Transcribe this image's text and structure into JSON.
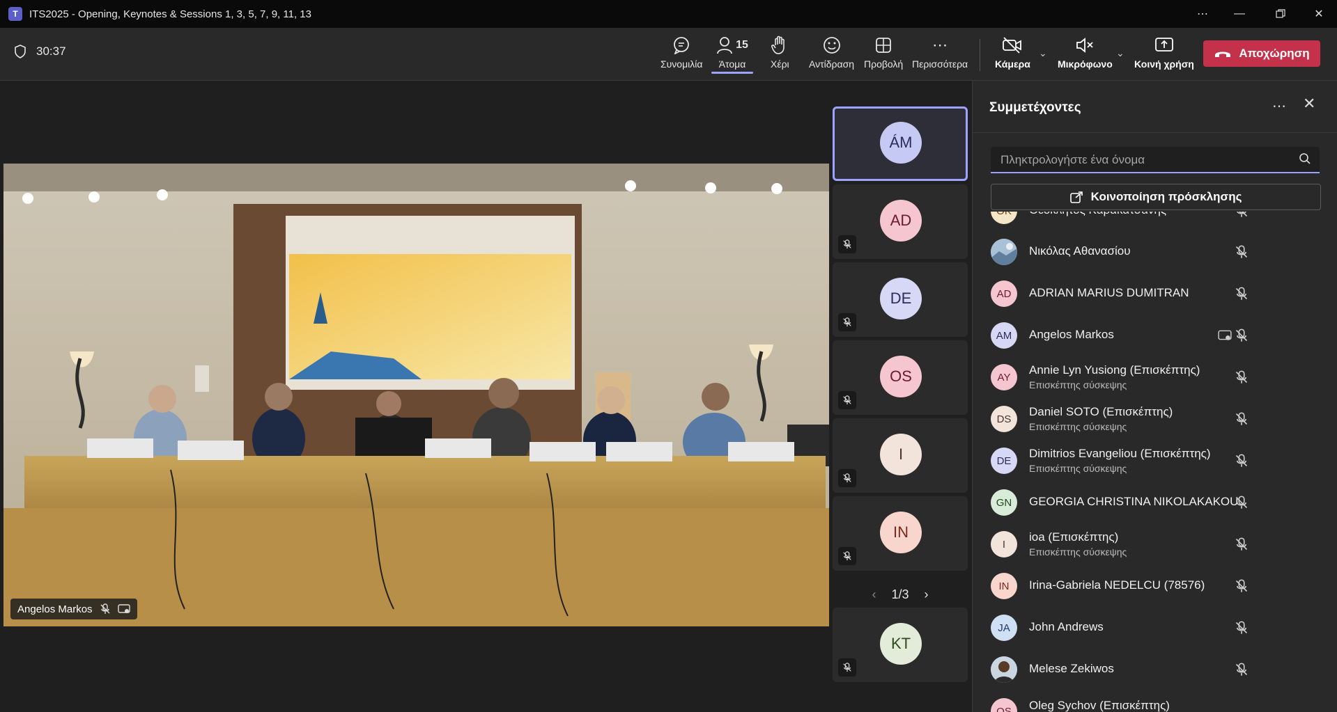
{
  "window": {
    "title": "ITS2025 - Opening, Keynotes & Sessions 1, 3, 5, 7, 9, 11, 13",
    "app_icon": "teams-logo-icon",
    "controls": [
      "more-icon",
      "minimize-icon",
      "restore-icon",
      "close-icon"
    ]
  },
  "toolbar": {
    "timer": "30:37",
    "people_count": "15",
    "chat_label": "Συνομιλία",
    "people_label": "Άτομα",
    "raise_hand_label": "Χέρι",
    "react_label": "Αντίδραση",
    "view_label": "Προβολή",
    "more_label": "Περισσότερα",
    "camera_label": "Κάμερα",
    "mic_label": "Μικρόφωνο",
    "share_label": "Κοινή χρήση",
    "leave_label": "Αποχώρηση",
    "leave_color": "#c4314b"
  },
  "stage": {
    "speaker_name": "Angelos Markos",
    "tiles": [
      {
        "initials": "ÁM",
        "bg": "#c7c9f5",
        "fg": "#2b2d5c",
        "muted": false,
        "active": true
      },
      {
        "initials": "AD",
        "bg": "#f5c6cf",
        "fg": "#6b1b2b",
        "muted": true,
        "active": false
      },
      {
        "initials": "DE",
        "bg": "#d6d8f5",
        "fg": "#2b2d5c",
        "muted": true,
        "active": false
      },
      {
        "initials": "OS",
        "bg": "#f5c6cf",
        "fg": "#6b1b2b",
        "muted": true,
        "active": false
      },
      {
        "initials": "I",
        "bg": "#f2e4da",
        "fg": "#4a3426",
        "muted": true,
        "active": false
      },
      {
        "initials": "IN",
        "bg": "#f9d6cd",
        "fg": "#7a2a1a",
        "muted": true,
        "active": false
      },
      {
        "initials": "KT",
        "bg": "#e2ecd9",
        "fg": "#2e4a1e",
        "muted": true,
        "active": false
      }
    ],
    "pager": "1/3"
  },
  "panel": {
    "title": "Συμμετέχοντες",
    "search_placeholder": "Πληκτρολογήστε ένα όνομα",
    "share_invite_label": "Κοινοποίηση πρόσκλησης",
    "participants": [
      {
        "initials": "ΘΚ",
        "name": "Θεόκλητος Καρακατσάνης",
        "sub": "",
        "bg": "#f5e6c8",
        "fg": "#6b4a12",
        "photo": false
      },
      {
        "initials": "",
        "name": "Νικόλας Αθανασίου",
        "sub": "",
        "bg": "#8ea9c2",
        "fg": "#ffffff",
        "photo": true
      },
      {
        "initials": "AD",
        "name": "ADRIAN MARIUS DUMITRAN",
        "sub": "",
        "bg": "#f5c6cf",
        "fg": "#6b1b2b",
        "photo": false
      },
      {
        "initials": "AM",
        "name": "Angelos Markos",
        "sub": "",
        "bg": "#d6d8f5",
        "fg": "#2b2d5c",
        "photo": false,
        "sharing": true
      },
      {
        "initials": "AY",
        "name": "Annie Lyn Yusiong (Επισκέπτης)",
        "sub": "Επισκέπτης σύσκεψης",
        "bg": "#f5c6cf",
        "fg": "#6b1b2b",
        "photo": false
      },
      {
        "initials": "DS",
        "name": "Daniel SOTO (Επισκέπτης)",
        "sub": "Επισκέπτης σύσκεψης",
        "bg": "#f2e4da",
        "fg": "#4a3426",
        "photo": false
      },
      {
        "initials": "DE",
        "name": "Dimitrios Evangeliou (Επισκέπτης)",
        "sub": "Επισκέπτης σύσκεψης",
        "bg": "#d6d8f5",
        "fg": "#2b2d5c",
        "photo": false
      },
      {
        "initials": "GN",
        "name": "GEORGIA CHRISTINA NIKOLAKAKOU",
        "sub": "",
        "bg": "#d9ecd9",
        "fg": "#1e4a1e",
        "photo": false
      },
      {
        "initials": "I",
        "name": "ioa (Επισκέπτης)",
        "sub": "Επισκέπτης σύσκεψης",
        "bg": "#f2e4da",
        "fg": "#4a3426",
        "photo": false
      },
      {
        "initials": "IN",
        "name": "Irina-Gabriela NEDELCU (78576)",
        "sub": "",
        "bg": "#f9d6cd",
        "fg": "#7a2a1a",
        "photo": false
      },
      {
        "initials": "JA",
        "name": "John Andrews",
        "sub": "",
        "bg": "#cfe0f5",
        "fg": "#1b3a6b",
        "photo": false
      },
      {
        "initials": "",
        "name": "Melese Zekiwos",
        "sub": "",
        "bg": "#6b8fb0",
        "fg": "#ffffff",
        "photo": true
      },
      {
        "initials": "OS",
        "name": "Oleg Sychov (Επισκέπτης)",
        "sub": "",
        "bg": "#f5c6cf",
        "fg": "#6b1b2b",
        "photo": false
      }
    ]
  }
}
